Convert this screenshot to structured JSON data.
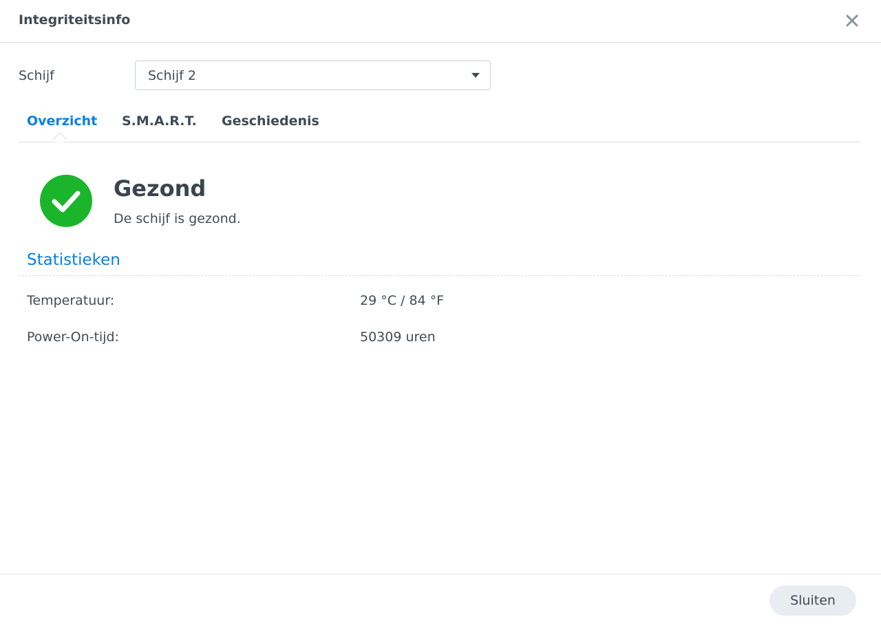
{
  "window": {
    "title": "Integriteitsinfo"
  },
  "disk_selector": {
    "label": "Schijf",
    "selected_value": "Schijf 2"
  },
  "tabs": [
    {
      "label": "Overzicht",
      "active": true
    },
    {
      "label": "S.M.A.R.T.",
      "active": false
    },
    {
      "label": "Geschiedenis",
      "active": false
    }
  ],
  "status": {
    "icon": "check-circle-icon",
    "title": "Gezond",
    "description": "De schijf is gezond.",
    "color": "#1bb52c"
  },
  "statistics": {
    "title": "Statistieken",
    "rows": [
      {
        "label": "Temperatuur:",
        "value": "29 °C / 84 °F"
      },
      {
        "label": "Power-On-tijd:",
        "value": "50309 uren"
      }
    ]
  },
  "footer": {
    "close_label": "Sluiten"
  },
  "colors": {
    "accent": "#0b80e0",
    "text": "#414b55",
    "healthy": "#1bb52c",
    "button_bg": "#e9edf2"
  }
}
